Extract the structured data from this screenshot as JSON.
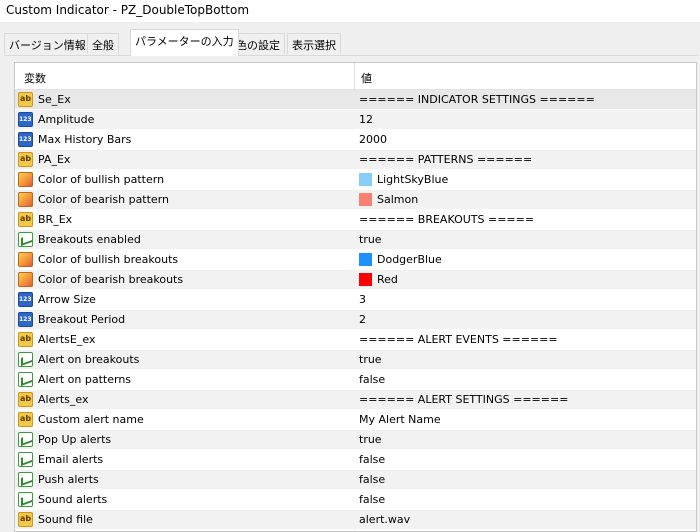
{
  "window": {
    "title": "Custom Indicator - PZ_DoubleTopBottom"
  },
  "tabs": [
    {
      "label": "バージョン情報"
    },
    {
      "label": "全般"
    },
    {
      "label": "パラメーターの入力"
    },
    {
      "label": "色の設定"
    },
    {
      "label": "表示選択"
    }
  ],
  "active_tab": "パラメーターの入力",
  "grid": {
    "col_variable": "変数",
    "col_value": "値",
    "rows": [
      {
        "icon": "ab-string-icon",
        "name": "Se_Ex",
        "value": "====== INDICATOR SETTINGS ======"
      },
      {
        "icon": "number-icon",
        "name": "Amplitude",
        "value": "12"
      },
      {
        "icon": "number-icon",
        "name": "Max History Bars",
        "value": "2000"
      },
      {
        "icon": "ab-string-icon",
        "name": "PA_Ex",
        "value": "====== PATTERNS ======"
      },
      {
        "icon": "color-icon",
        "name": "Color of bullish pattern",
        "value": "LightSkyBlue",
        "swatch": "#87cefa"
      },
      {
        "icon": "color-icon",
        "name": "Color of bearish pattern",
        "value": "Salmon",
        "swatch": "#fa8072"
      },
      {
        "icon": "ab-string-icon",
        "name": "BR_Ex",
        "value": "====== BREAKOUTS ====="
      },
      {
        "icon": "bool-icon",
        "name": "Breakouts enabled",
        "value": "true"
      },
      {
        "icon": "color-icon",
        "name": "Color of bullish breakouts",
        "value": "DodgerBlue",
        "swatch": "#1e90ff"
      },
      {
        "icon": "color-icon",
        "name": "Color of bearish breakouts",
        "value": "Red",
        "swatch": "#ff0000"
      },
      {
        "icon": "number-icon",
        "name": "Arrow Size",
        "value": "3"
      },
      {
        "icon": "number-icon",
        "name": "Breakout Period",
        "value": "2"
      },
      {
        "icon": "ab-string-icon",
        "name": "AlertsE_ex",
        "value": "====== ALERT EVENTS ======"
      },
      {
        "icon": "bool-icon",
        "name": "Alert on breakouts",
        "value": "true"
      },
      {
        "icon": "bool-icon",
        "name": "Alert on patterns",
        "value": "false"
      },
      {
        "icon": "ab-string-icon",
        "name": "Alerts_ex",
        "value": "====== ALERT SETTINGS ======"
      },
      {
        "icon": "ab-string-icon",
        "name": "Custom alert name",
        "value": "My Alert Name"
      },
      {
        "icon": "bool-icon",
        "name": "Pop Up alerts",
        "value": "true"
      },
      {
        "icon": "bool-icon",
        "name": "Email alerts",
        "value": "false"
      },
      {
        "icon": "bool-icon",
        "name": "Push alerts",
        "value": "false"
      },
      {
        "icon": "bool-icon",
        "name": "Sound alerts",
        "value": "false"
      },
      {
        "icon": "ab-string-icon",
        "name": "Sound file",
        "value": "alert.wav"
      }
    ]
  }
}
